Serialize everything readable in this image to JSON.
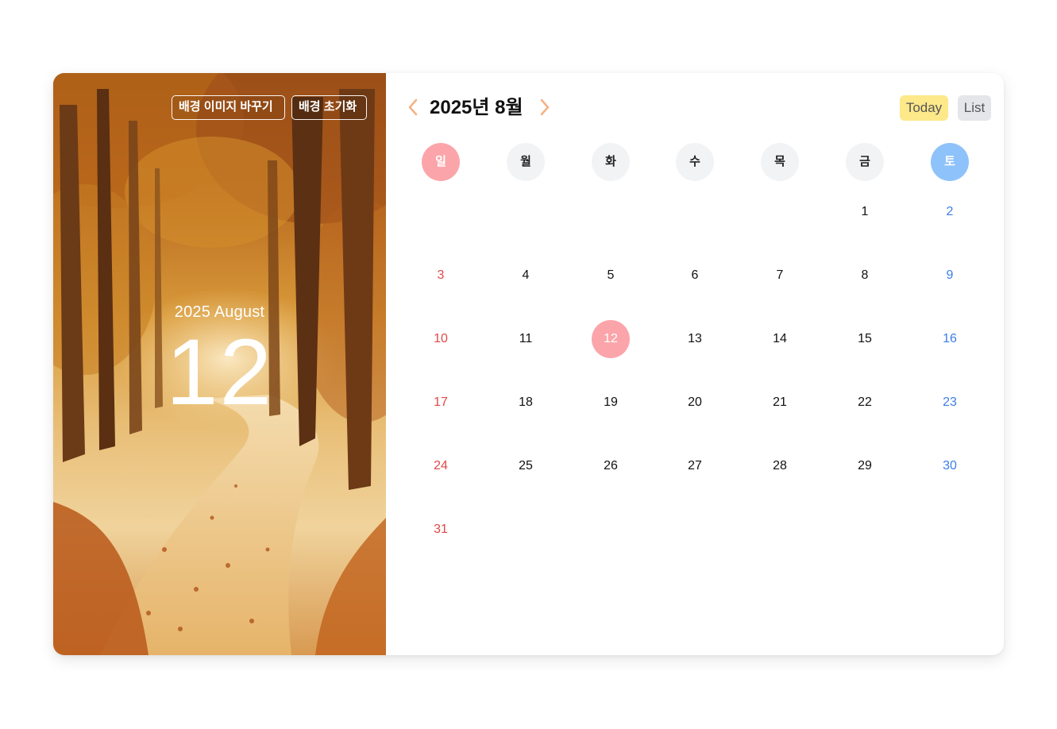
{
  "background_buttons": {
    "change_label": "배경 이미지 바꾸기",
    "reset_label": "배경 초기화"
  },
  "hero": {
    "month_label": "2025 August",
    "day": "12"
  },
  "header": {
    "title": "2025년 8월",
    "prev_icon": "chevron-left-icon",
    "next_icon": "chevron-right-icon",
    "today_label": "Today",
    "list_label": "List"
  },
  "weekdays": [
    "일",
    "월",
    "화",
    "수",
    "목",
    "금",
    "토"
  ],
  "calendar": {
    "first_weekday_index": 5,
    "days_in_month": 31,
    "today": 12
  },
  "colors": {
    "accent_arrow": "#f4b183",
    "today_button": "#fde88a",
    "list_button": "#e4e6ea",
    "sunday_circle": "#fba5aa",
    "saturday_circle": "#8ec2fb",
    "sunday_text": "#e04848",
    "saturday_text": "#3d7ee6"
  }
}
